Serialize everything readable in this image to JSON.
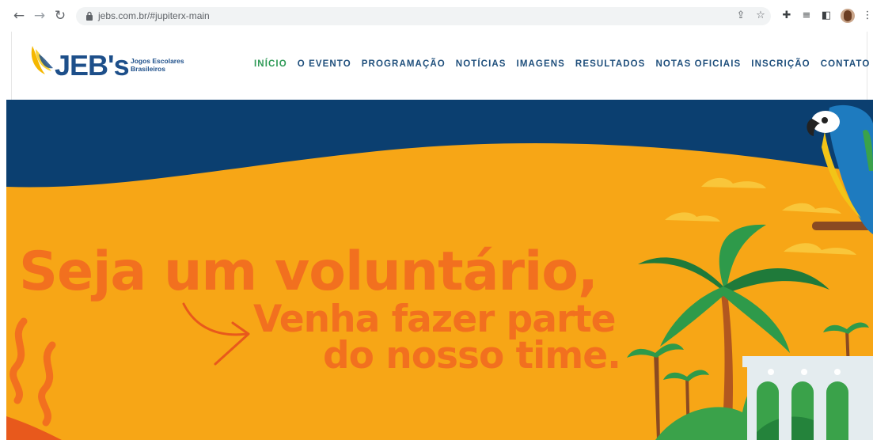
{
  "browser": {
    "url": "jebs.com.br/#jupiterx-main",
    "icons": [
      "back-arrow-icon",
      "forward-arrow-icon",
      "reload-icon",
      "lock-icon",
      "share-icon",
      "star-icon",
      "extensions-icon",
      "reading-list-icon",
      "side-panel-icon",
      "profile-avatar",
      "menu-dots-icon"
    ]
  },
  "site": {
    "logo": {
      "word": "JEB's",
      "sub_line1": "Jogos Escolares",
      "sub_line2": "Brasileiros"
    },
    "menu": [
      {
        "label": "INÍCIO",
        "active": true
      },
      {
        "label": "O EVENTO"
      },
      {
        "label": "PROGRAMAÇÃO"
      },
      {
        "label": "NOTÍCIAS"
      },
      {
        "label": "IMAGENS"
      },
      {
        "label": "RESULTADOS"
      },
      {
        "label": "NOTAS OFICIAIS"
      },
      {
        "label": "INSCRIÇÃO"
      },
      {
        "label": "CONTATO"
      }
    ]
  },
  "hero": {
    "line1": "Seja um voluntário,",
    "line2": "Venha fazer parte",
    "line3": "do nosso time."
  },
  "colors": {
    "hero_background": "#f7a616",
    "hero_band": "#0b3f70",
    "hero_text": "#f2701f",
    "menu_active": "#2f9a57",
    "menu_text": "#1f4f7c"
  }
}
